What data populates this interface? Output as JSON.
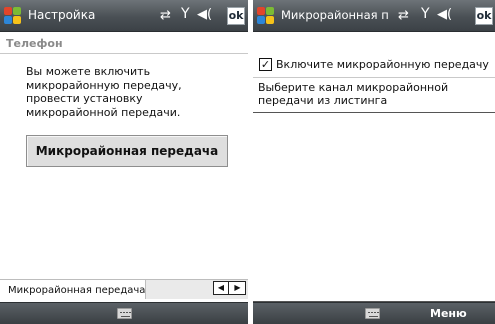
{
  "screen1": {
    "title": "Настройка",
    "ok_label": "ok",
    "section_header": "Телефон",
    "description": "Вы можете включить микрорайонную передачу, провести установку микрорайонной передачи.",
    "button_label": "Микрорайонная передача",
    "tab_label": "Микрорайонная передача",
    "scroll_left": "◀",
    "scroll_right": "▶"
  },
  "screen2": {
    "title": "Микрорайонная пер ",
    "ok_label": "ok",
    "checkbox_checked": true,
    "checkbox_mark": "✓",
    "checkbox_label": "Включите микрорайонную передачу",
    "instruction": "Выберите канал микрорайонной передачи из листинга",
    "softkey_right": "Меню"
  },
  "status_icons": {
    "sync": "⇄",
    "signal": "Y",
    "volume": "◀("
  },
  "colors": {
    "title_bar": "#4a5055",
    "softkey_bar": "#3a3f43",
    "logo_red": "#e2452b",
    "logo_green": "#7cbb34",
    "logo_blue": "#2d86d8",
    "logo_yellow": "#f5c21a"
  }
}
